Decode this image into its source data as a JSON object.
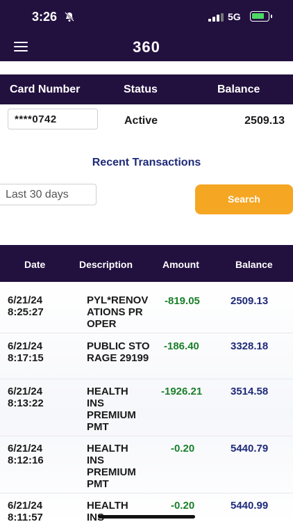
{
  "status_bar": {
    "time": "3:26",
    "network": "5G",
    "battery_level": 0.8
  },
  "header": {
    "logo": "360",
    "menu_icon": "hamburger-menu-icon"
  },
  "card_table": {
    "headers": {
      "card_number": "Card Number",
      "status": "Status",
      "balance": "Balance"
    },
    "card_number": "****0742",
    "status": "Active",
    "balance": "2509.13"
  },
  "transactions_section": {
    "title": "Recent Transactions",
    "range_value": "Last 30 days",
    "search_label": "Search"
  },
  "transactions_table": {
    "headers": {
      "date": "Date",
      "description": "Description",
      "amount": "Amount",
      "balance": "Balance"
    },
    "rows": [
      {
        "date": "6/21/24\n8:25:27",
        "description": "PYL*RENOVATIONS PROPER",
        "amount": "-819.05",
        "balance": "2509.13"
      },
      {
        "date": "6/21/24\n8:17:15",
        "description": "PUBLIC STORAGE 29199",
        "amount": "-186.40",
        "balance": "3328.18"
      },
      {
        "date": "6/21/24\n8:13:22",
        "description": "HEALTH INS PREMIUM PMT",
        "amount": "-1926.21",
        "balance": "3514.58"
      },
      {
        "date": "6/21/24\n8:12:16",
        "description": "HEALTH INS PREMIUM PMT",
        "amount": "-0.20",
        "balance": "5440.79"
      },
      {
        "date": "6/21/24\n8:11:57",
        "description": "HEALTH INS",
        "amount": "-0.20",
        "balance": "5440.99"
      }
    ]
  },
  "colors": {
    "primary": "#22103f",
    "accent": "#f5a623",
    "amount": "#1a7f2a",
    "balance": "#1e2a78"
  }
}
